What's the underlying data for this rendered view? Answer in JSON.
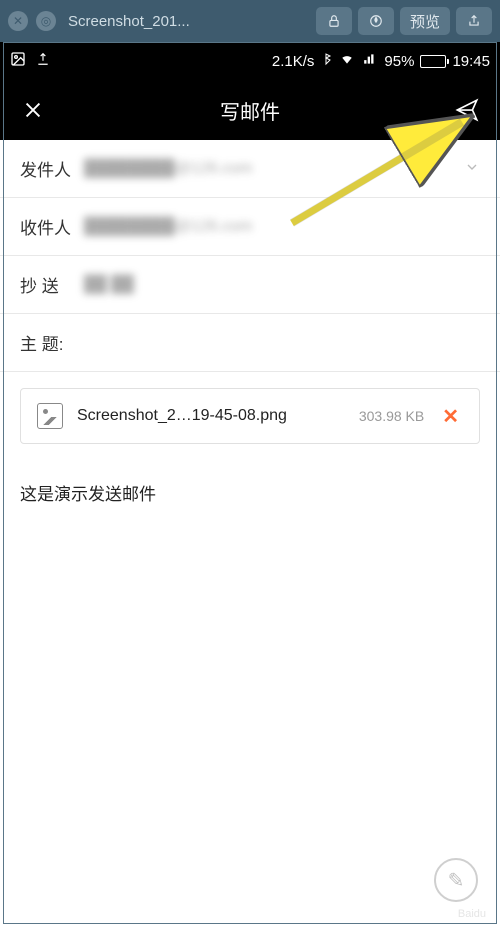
{
  "browser": {
    "tab_title": "Screenshot_201...",
    "preview_label": "预览"
  },
  "status": {
    "speed": "2.1K/s",
    "battery_pct": "95%",
    "time": "19:45"
  },
  "header": {
    "title": "写邮件"
  },
  "form": {
    "sender_label": "发件人",
    "sender_value": "████████@126.com",
    "recipient_label": "收件人",
    "recipient_value": "████████@126.com",
    "cc_label": "抄  送",
    "cc_value": "██ ██",
    "subject_label": "主  题:"
  },
  "attachment": {
    "filename": "Screenshot_2…19-45-08.png",
    "size": "303.98 KB"
  },
  "body": {
    "text": "这是演示发送邮件"
  },
  "watermark": "Baidu"
}
